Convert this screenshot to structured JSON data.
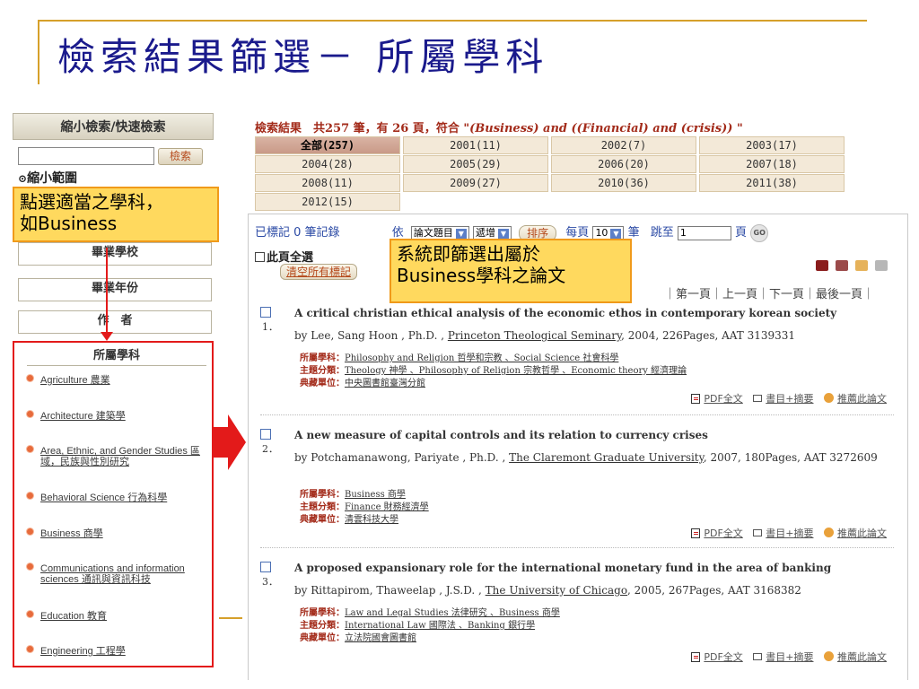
{
  "slide": {
    "title": "檢索結果篩選－ 所屬學科"
  },
  "sidebar": {
    "header": "縮小檢索/快速檢索",
    "search_button": "檢索",
    "narrow_range": "縮小範圍",
    "sections": [
      {
        "label": "畢業學校"
      },
      {
        "label": "畢業年份"
      },
      {
        "label": "作　者"
      }
    ],
    "subject_panel_title": "所屬學科",
    "subjects": [
      {
        "label": "Agriculture 農業"
      },
      {
        "label": "Architecture 建築學"
      },
      {
        "label": "Area, Ethnic, and Gender Studies 區域，民族與性別研究"
      },
      {
        "label": "Behavioral Science 行為科學"
      },
      {
        "label": "Business 商學"
      },
      {
        "label": "Communications and information sciences 通訊與資訊科技"
      },
      {
        "label": "Education 教育"
      },
      {
        "label": "Engineering 工程學"
      }
    ]
  },
  "callouts": {
    "left_line1": "點選適當之學科，",
    "left_line2": "如Business",
    "right_line1": "系統即篩選出屬於",
    "right_line2": "Business學科之論文"
  },
  "results": {
    "summary_prefix": "檢索結果　共257 筆，有 26 頁，",
    "summary_match": "符合",
    "query": "\"(Business) and ((Financial) and (crisis)) \"",
    "year_tabs": [
      {
        "label": "全部(257)",
        "active": true
      },
      {
        "label": "2001(11)"
      },
      {
        "label": "2002(7)"
      },
      {
        "label": "2003(17)"
      },
      {
        "label": "2004(28)"
      },
      {
        "label": "2005(29)"
      },
      {
        "label": "2006(20)"
      },
      {
        "label": "2007(18)"
      },
      {
        "label": "2008(11)"
      },
      {
        "label": "2009(27)"
      },
      {
        "label": "2010(36)"
      },
      {
        "label": "2011(38)"
      },
      {
        "label": "2012(15)"
      }
    ],
    "marked_count": "已標記 0 筆記錄",
    "sort_by_label": "依",
    "sort_field": "論文題目",
    "sort_order": "遞增",
    "sort_button": "排序",
    "per_page_label": "每頁",
    "per_page_value": "10",
    "per_page_unit": "筆",
    "jump_label": "跳至",
    "jump_value": "1",
    "page_unit": "頁",
    "go_button": "GO",
    "select_all": "此頁全選",
    "clear_marks": "清空所有標記",
    "pager": "｜第一頁｜上一頁｜下一頁｜最後一頁｜",
    "records": [
      {
        "num": "1．",
        "title": "A critical christian ethical analysis of the economic ethos in contemporary korean society",
        "by_prefix": "by Lee, Sang Hoon , Ph.D. , ",
        "university": "Princeton Theological Seminary",
        "by_suffix": ", 2004, 226Pages, AAT 3139331",
        "subject_label": "所屬學科：",
        "subjects": "Philosophy and Religion 哲學和宗教 、Social Science 社會科學",
        "topic_label": "主題分類：",
        "topics": "Theology 神學 、Philosophy of Religion 宗教哲學 、Economic theory 經濟理論",
        "holder_label": "典藏單位：",
        "holder": "中央圖書館臺灣分館"
      },
      {
        "num": "2．",
        "title": "A new measure of capital controls and its relation to currency crises",
        "by_prefix": "by Potchamanawong, Pariyate , Ph.D. , ",
        "university": "The Claremont Graduate University",
        "by_suffix": ", 2007, 180Pages, AAT 3272609",
        "subject_label": "所屬學科：",
        "subjects": "Business 商學",
        "topic_label": "主題分類：",
        "topics": "Finance 財務經濟學",
        "holder_label": "典藏單位：",
        "holder": "清雲科技大學"
      },
      {
        "num": "3．",
        "title": "A proposed expansionary role for the international monetary fund in the area of banking",
        "by_prefix": "by Rittapirom, Thaweelap , J.S.D. , ",
        "university": "The University of Chicago",
        "by_suffix": ", 2005, 267Pages, AAT 3168382",
        "subject_label": "所屬學科：",
        "subjects": "Law and Legal Studies 法律研究 、Business 商學",
        "topic_label": "主題分類：",
        "topics": "International Law 國際法 、Banking 銀行學",
        "holder_label": "典藏單位：",
        "holder": "立法院國會圖書館"
      }
    ],
    "actions": {
      "pdf": "PDF全文",
      "abstract": "書目+摘要",
      "recommend": "推薦此論文"
    }
  },
  "colors": {
    "title": "#1a1a8c",
    "highlight_frame": "#e31a1a",
    "callout_bg": "#ffd95e",
    "callout_border": "#f09a1a",
    "result_label": "#a32b1a"
  }
}
